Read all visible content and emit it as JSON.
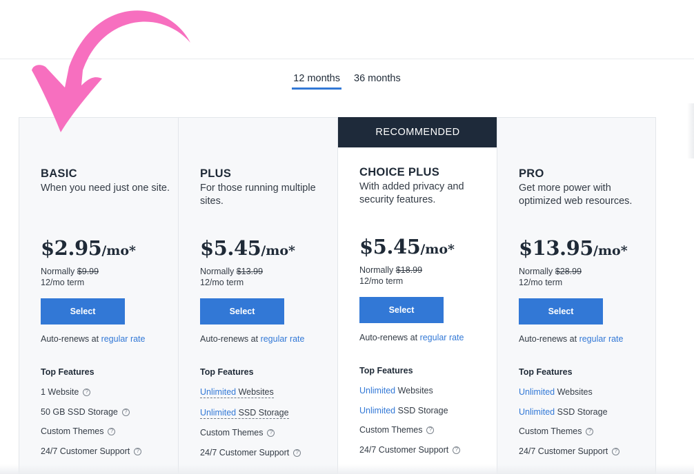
{
  "term_tabs": [
    {
      "label": "12 months",
      "active": true
    },
    {
      "label": "36 months",
      "active": false
    }
  ],
  "plans": [
    {
      "name": "BASIC",
      "description": "When you need just one site.",
      "price": "$2.95",
      "per": "/mo*",
      "normally_label": "Normally",
      "normally_price": "$9.99",
      "term": "12/mo term",
      "select_label": "Select",
      "auto_renew_text": "Auto-renews at",
      "auto_renew_link": "regular rate",
      "features_title": "Top Features",
      "features": [
        {
          "highlight": "",
          "text": "1 Website",
          "dashed": false
        },
        {
          "highlight": "",
          "text": "50 GB SSD Storage",
          "dashed": false
        },
        {
          "highlight": "",
          "text": "Custom Themes",
          "dashed": false
        },
        {
          "highlight": "",
          "text": "24/7 Customer Support",
          "dashed": false
        }
      ]
    },
    {
      "name": "PLUS",
      "description": "For those running multiple sites.",
      "price": "$5.45",
      "per": "/mo*",
      "normally_label": "Normally",
      "normally_price": "$13.99",
      "term": "12/mo term",
      "select_label": "Select",
      "auto_renew_text": "Auto-renews at",
      "auto_renew_link": "regular rate",
      "features_title": "Top Features",
      "features": [
        {
          "highlight": "Unlimited",
          "text": " Websites",
          "dashed": true
        },
        {
          "highlight": "Unlimited",
          "text": " SSD Storage",
          "dashed": true
        },
        {
          "highlight": "",
          "text": "Custom Themes",
          "dashed": false
        },
        {
          "highlight": "",
          "text": "24/7 Customer Support",
          "dashed": false
        }
      ]
    },
    {
      "name": "CHOICE PLUS",
      "description": "With added privacy and security features.",
      "badge": "RECOMMENDED",
      "price": "$5.45",
      "per": "/mo*",
      "normally_label": "Normally",
      "normally_price": "$18.99",
      "term": "12/mo term",
      "select_label": "Select",
      "auto_renew_text": "Auto-renews at",
      "auto_renew_link": "regular rate",
      "features_title": "Top Features",
      "features": [
        {
          "highlight": "Unlimited",
          "text": " Websites",
          "dashed": false
        },
        {
          "highlight": "Unlimited",
          "text": " SSD Storage",
          "dashed": false
        },
        {
          "highlight": "",
          "text": "Custom Themes",
          "dashed": false
        },
        {
          "highlight": "",
          "text": "24/7 Customer Support",
          "dashed": false
        }
      ]
    },
    {
      "name": "PRO",
      "description": "Get more power with optimized web resources.",
      "price": "$13.95",
      "per": "/mo*",
      "normally_label": "Normally",
      "normally_price": "$28.99",
      "term": "12/mo term",
      "select_label": "Select",
      "auto_renew_text": "Auto-renews at",
      "auto_renew_link": "regular rate",
      "features_title": "Top Features",
      "features": [
        {
          "highlight": "Unlimited",
          "text": " Websites",
          "dashed": false
        },
        {
          "highlight": "Unlimited",
          "text": " SSD Storage",
          "dashed": false
        },
        {
          "highlight": "",
          "text": "Custom Themes",
          "dashed": false
        },
        {
          "highlight": "",
          "text": "24/7 Customer Support",
          "dashed": false
        }
      ]
    }
  ],
  "help_glyph": "?",
  "icons": {
    "annotation": "curved-arrow-icon",
    "help": "help-circle-icon"
  },
  "colors": {
    "accent": "#3278d6",
    "banner": "#1e2a3a",
    "annotation_arrow": "#f76fbf",
    "card_bg": "#f7f8fa"
  }
}
